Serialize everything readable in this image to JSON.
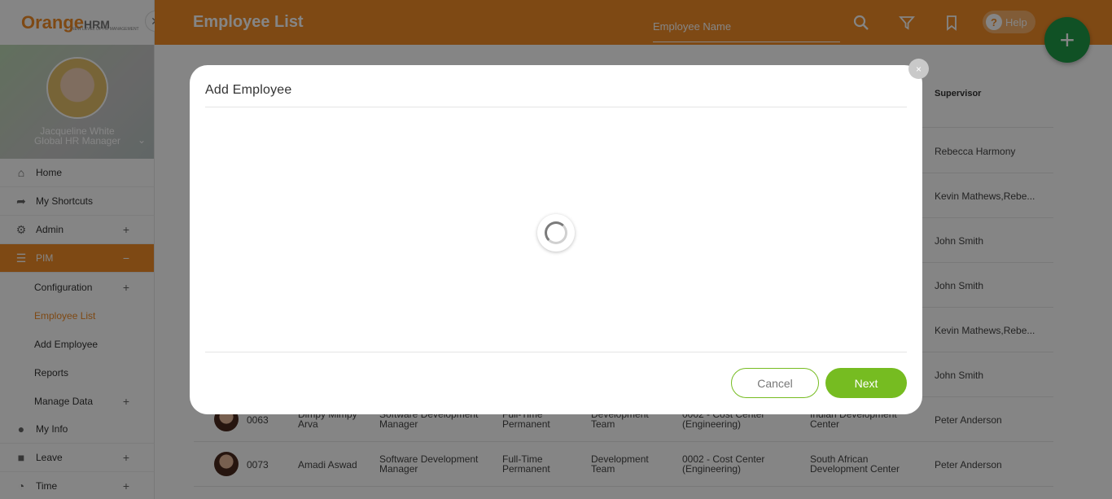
{
  "brand": {
    "logo_main": "Orange",
    "logo_hrm": "HRM",
    "tagline": "NEW LEVEL OF HR MANAGEMENT"
  },
  "profile": {
    "name": "Jacqueline White",
    "title": "Global HR Manager"
  },
  "nav": [
    {
      "label": "Home",
      "icon": "home-icon"
    },
    {
      "label": "My Shortcuts",
      "icon": "shortcut-icon"
    },
    {
      "label": "Admin",
      "icon": "admin-icon",
      "expand": "+"
    },
    {
      "label": "PIM",
      "icon": "pim-icon",
      "expand": "−"
    }
  ],
  "pim_sub": [
    {
      "label": "Configuration",
      "expand": "+"
    },
    {
      "label": "Employee List",
      "expand": ""
    },
    {
      "label": "Add Employee",
      "expand": ""
    },
    {
      "label": "Reports",
      "expand": ""
    },
    {
      "label": "Manage Data",
      "expand": "+"
    }
  ],
  "nav_bottom": [
    {
      "label": "My Info",
      "icon": "user-icon",
      "expand": ""
    },
    {
      "label": "Leave",
      "icon": "briefcase-icon",
      "expand": "+"
    },
    {
      "label": "Time",
      "icon": "clock-icon",
      "expand": "+"
    }
  ],
  "topbar": {
    "title": "Employee List",
    "search_placeholder": "Employee Name",
    "help_label": "Help"
  },
  "table": {
    "supervisor_header": "Supervisor",
    "supervisors": [
      "Rebecca Harmony",
      "Kevin Mathews,Rebe...",
      "John Smith",
      "John Smith",
      "Kevin Mathews,Rebe...",
      "John Smith"
    ],
    "rows": [
      {
        "id": "0063",
        "name": "Dimpy Mimpy Arva",
        "job": "Software Development Manager",
        "status": "Full-Time Permanent",
        "unit": "Development Team",
        "cost": "0002 - Cost Center (Engineering)",
        "location": "Indian Development Center",
        "supervisor": "Peter Anderson"
      },
      {
        "id": "0073",
        "name": "Amadi Aswad",
        "job": "Software Development Manager",
        "status": "Full-Time Permanent",
        "unit": "Development Team",
        "cost": "0002 - Cost Center (Engineering)",
        "location": "South African Development Center",
        "supervisor": "Peter Anderson"
      }
    ]
  },
  "modal": {
    "title": "Add Employee",
    "close": "×",
    "cancel_label": "Cancel",
    "next_label": "Next"
  },
  "colors": {
    "accent": "#f28c28",
    "green": "#76bc21",
    "fab": "#1f9b47"
  }
}
